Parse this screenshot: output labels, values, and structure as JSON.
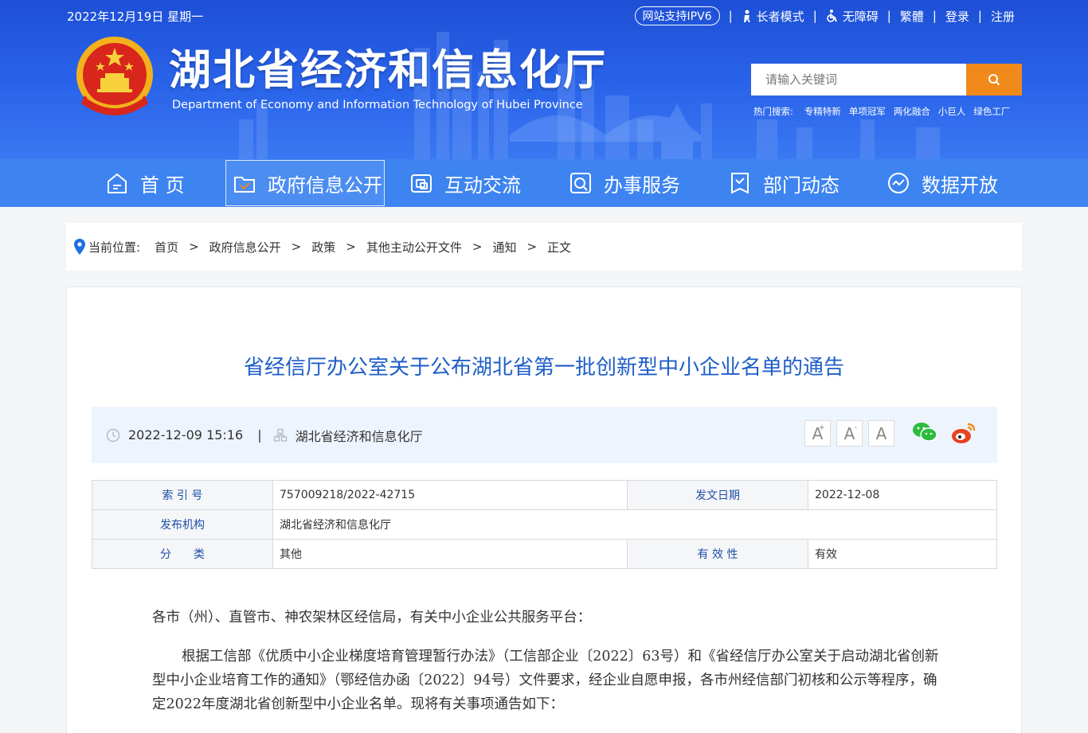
{
  "topbar": {
    "date": "2022年12月19日 星期一",
    "ipv6": "网站支持IPV6",
    "elder_mode": "长者模式",
    "accessibility": "无障碍",
    "traditional": "繁體",
    "login": "登录",
    "register": "注册"
  },
  "site": {
    "title": "湖北省经济和信息化厅",
    "subtitle": "Department of Economy and Information Technology of Hubei Province"
  },
  "search": {
    "placeholder": "请输入关键词",
    "hot_label": "热门搜索:",
    "hot_keywords": [
      "专精特新",
      "单项冠军",
      "两化融合",
      "小巨人",
      "绿色工厂"
    ]
  },
  "nav": {
    "items": [
      "首 页",
      "政府信息公开",
      "互动交流",
      "办事服务",
      "部门动态",
      "数据开放"
    ],
    "active": "政府信息公开"
  },
  "breadcrumb": {
    "label": "当前位置:",
    "items": [
      "首页",
      "政府信息公开",
      "政策",
      "其他主动公开文件",
      "通知",
      "正文"
    ]
  },
  "article": {
    "title": "省经信厅办公室关于公布湖北省第一批创新型中小企业名单的通告",
    "datetime": "2022-12-09 15:16",
    "source": "湖北省经济和信息化厅",
    "font_buttons": [
      "A",
      "A",
      "A"
    ]
  },
  "info_table": {
    "index_label": "索 引 号",
    "index_value": "757009218/2022-42715",
    "date_label": "发文日期",
    "date_value": "2022-12-08",
    "issuer_label": "发布机构",
    "issuer_value": "湖北省经济和信息化厅",
    "category_label": "分　　类",
    "category_value": "其他",
    "validity_label": "有 效 性",
    "validity_value": "有效"
  },
  "body": {
    "salutation": "各市（州）、直管市、神农架林区经信局，有关中小企业公共服务平台：",
    "paragraph1": "根据工信部《优质中小企业梯度培育管理暂行办法》（工信部企业〔2022〕63号）和《省经信厅办公室关于启动湖北省创新型中小企业培育工作的通知》（鄂经信办函〔2022〕94号）文件要求，经企业自愿申报，各市州经信部门初核和公示等程序，确定2022年度湖北省创新型中小企业名单。现将有关事项通告如下："
  },
  "colors": {
    "header_blue": "#2a64ea",
    "nav_blue": "#3d84f0",
    "search_orange": "#f28a1b",
    "title_blue": "#1e5ec8"
  }
}
